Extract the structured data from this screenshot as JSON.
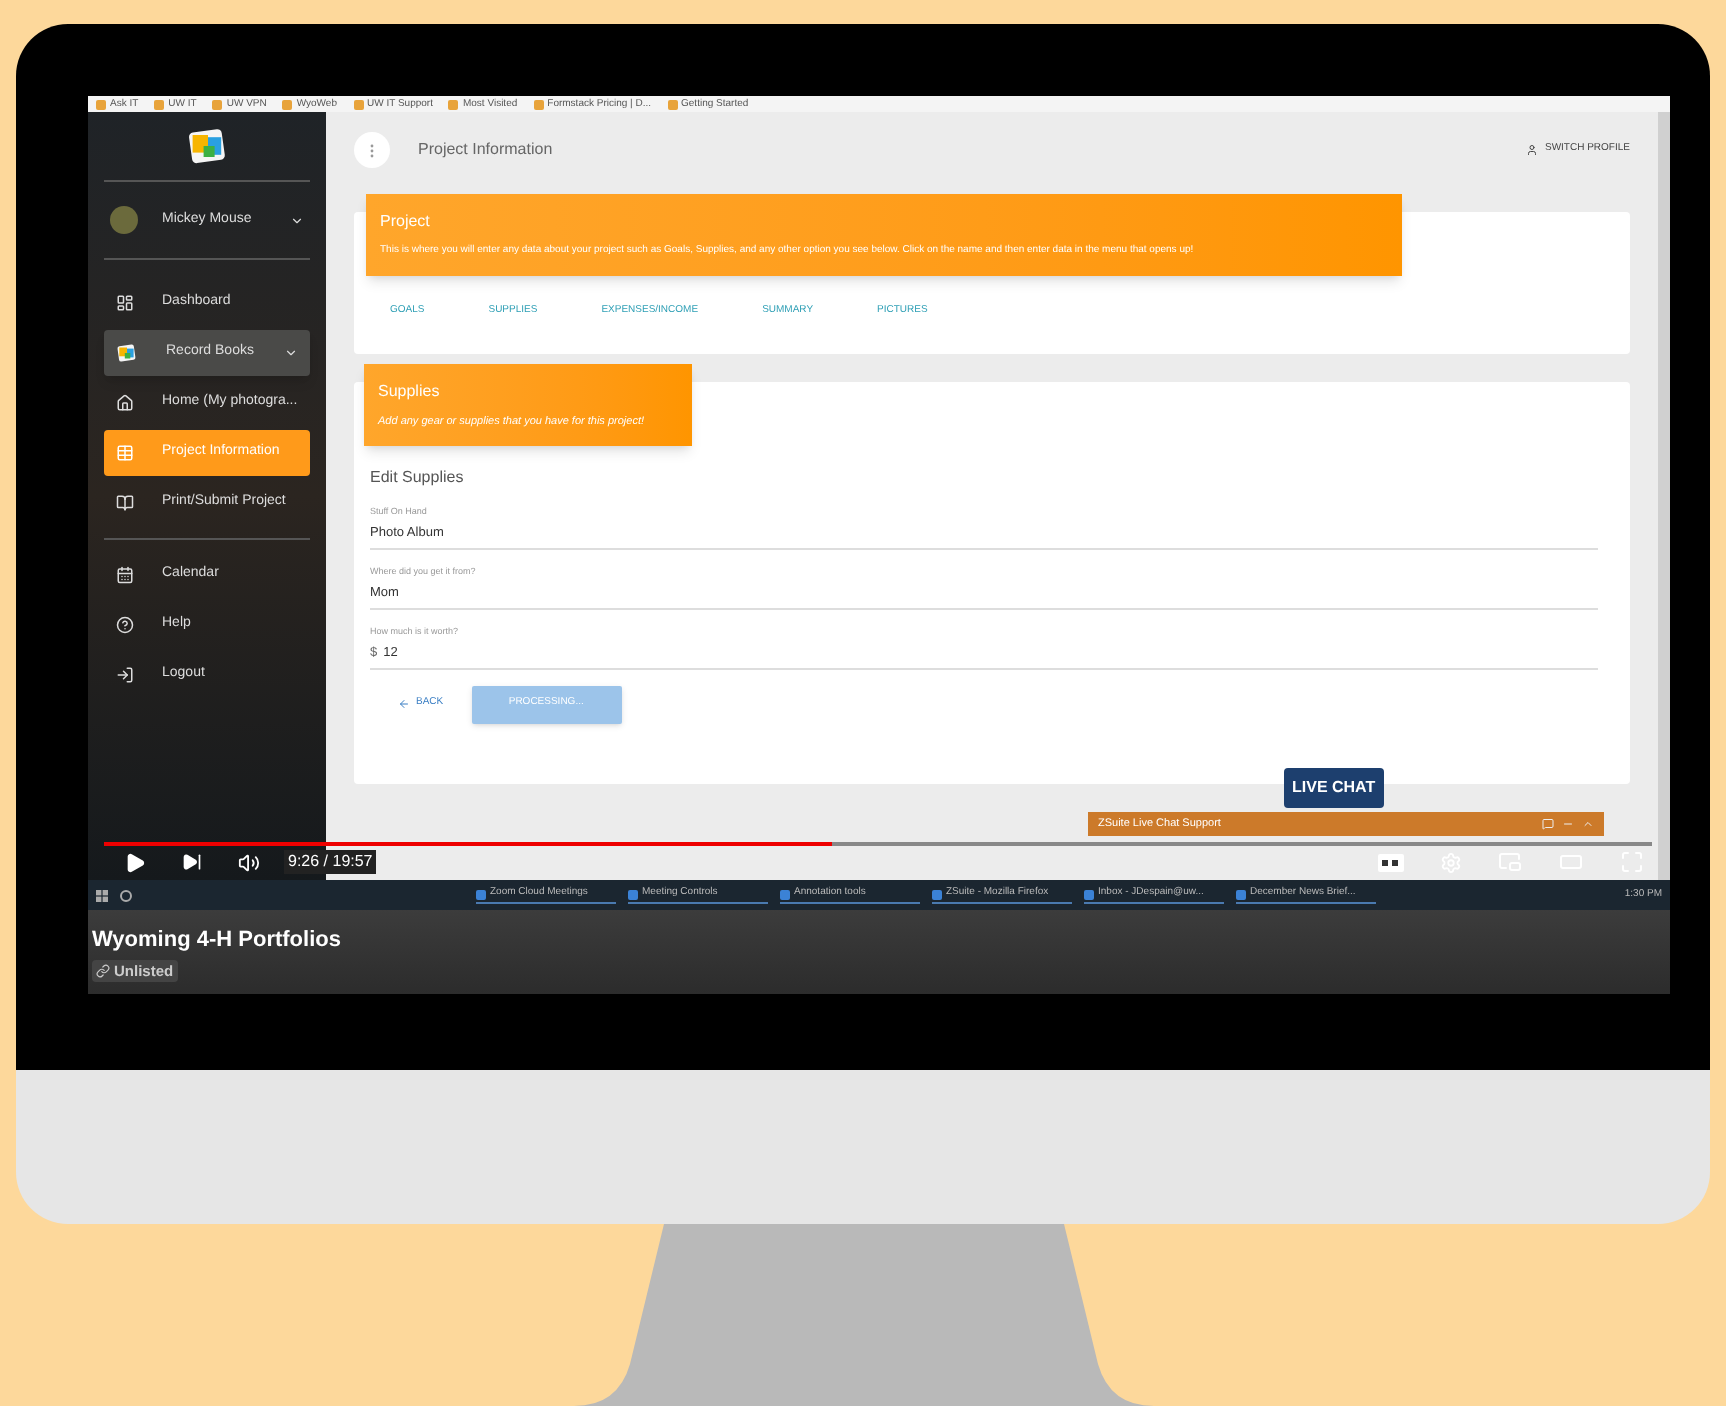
{
  "bookmarks": [
    "Ask IT",
    "UW IT",
    "UW VPN",
    "WyoWeb",
    "UW IT Support",
    "Most Visited",
    "Formstack Pricing | D...",
    "Getting Started"
  ],
  "sidebar": {
    "user": {
      "name": "Mickey Mouse"
    },
    "sections": [
      [
        {
          "label": "Dashboard",
          "selected": false,
          "highlighted": false,
          "caret": false
        },
        {
          "label": "Record Books",
          "selected": false,
          "highlighted": true,
          "caret": true
        },
        {
          "label": "Home (My photogra...",
          "selected": false,
          "highlighted": false,
          "caret": false
        },
        {
          "label": "Project Information",
          "selected": true,
          "highlighted": false,
          "caret": false
        },
        {
          "label": "Print/Submit Project",
          "selected": false,
          "highlighted": false,
          "caret": false
        }
      ],
      [
        {
          "label": "Calendar",
          "selected": false,
          "highlighted": false,
          "caret": false
        },
        {
          "label": "Help",
          "selected": false,
          "highlighted": false,
          "caret": false
        },
        {
          "label": "Logout",
          "selected": false,
          "highlighted": false,
          "caret": false
        }
      ]
    ]
  },
  "header": {
    "title": "Project Information",
    "switch_profile": "SWITCH PROFILE"
  },
  "project_card": {
    "title": "Project",
    "description": "This is where you will enter any data about your project such as Goals, Supplies, and any other option you see below. Click on the name and then enter data in the menu that opens up!",
    "tabs": [
      "GOALS",
      "SUPPLIES",
      "EXPENSES/INCOME",
      "SUMMARY",
      "PICTURES"
    ]
  },
  "supplies_card": {
    "title": "Supplies",
    "subtitle": "Add any gear or supplies that you have for this project!",
    "heading": "Edit Supplies",
    "fields": [
      {
        "label": "Stuff On Hand",
        "value": "Photo Album"
      },
      {
        "label": "Where did you get it from?",
        "value": "Mom"
      },
      {
        "label": "How much is it worth?",
        "prefix": "$",
        "value": "12"
      }
    ],
    "back": "BACK",
    "submit": {
      "label": "PROCESSING...",
      "disabled": true
    }
  },
  "live_chat": {
    "badge": "LIVE CHAT",
    "bar": "ZSuite Live Chat Support"
  },
  "taskbar": {
    "windows": [
      "Zoom Cloud Meetings",
      "Meeting Controls",
      "Annotation tools",
      "ZSuite - Mozilla Firefox",
      "Inbox - JDespain@uw...",
      "December News Brief..."
    ],
    "clock": "1:30 PM"
  },
  "player": {
    "time": "9:26 / 19:57",
    "progress": {
      "level": 0.47
    }
  },
  "video": {
    "title": "Wyoming 4-H Portfolios",
    "visibility": "Unlisted"
  }
}
